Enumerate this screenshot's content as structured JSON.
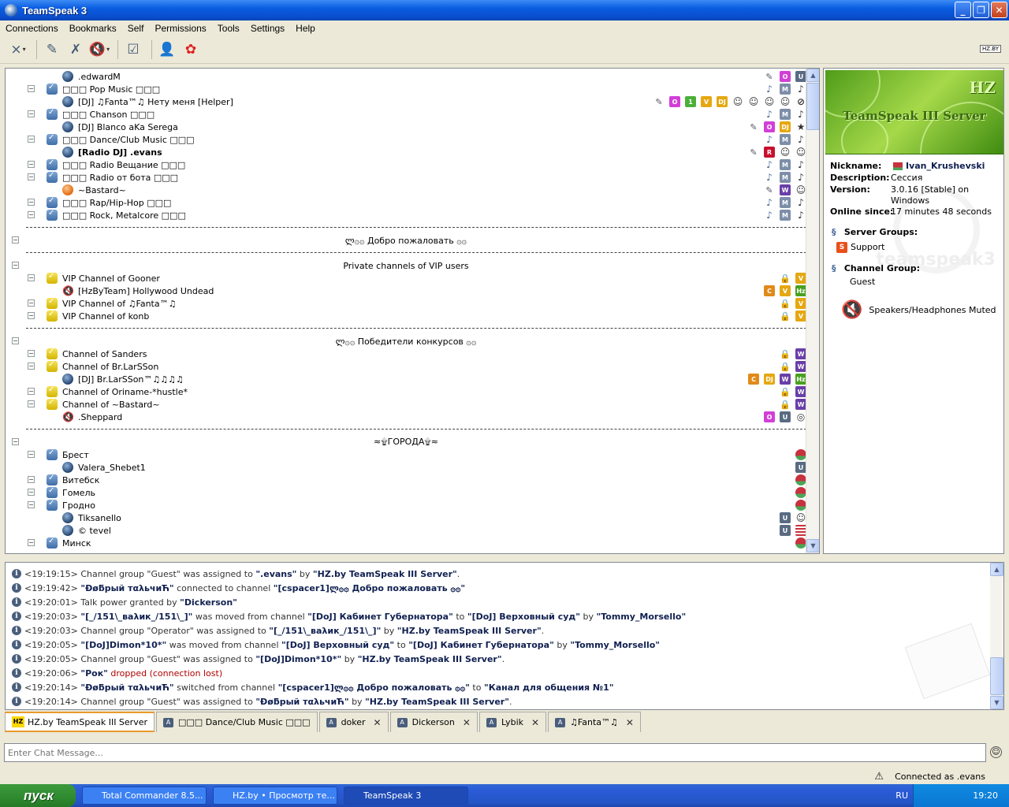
{
  "window": {
    "title": "TeamSpeak 3"
  },
  "menu": [
    "Connections",
    "Bookmarks",
    "Self",
    "Permissions",
    "Tools",
    "Settings",
    "Help"
  ],
  "toolbar_icons": [
    "disconnect-icon",
    "connect-icon",
    "mute-mic-icon",
    "mute-speakers-icon",
    "away-icon",
    "contacts-icon",
    "plugin-icon"
  ],
  "tree": {
    "rows": [
      {
        "type": "client",
        "label": ".edwardM",
        "badges": [
          "mic",
          "O",
          "U"
        ]
      },
      {
        "type": "channel",
        "label": "□□□ Pop Music □□□",
        "badges": [
          "music",
          "M",
          "♪"
        ]
      },
      {
        "type": "client",
        "label": "[DJ] ♫Fanta™♫ Нету меня [Helper]",
        "badges": [
          "mic",
          "O",
          "1",
          "V",
          "DJ",
          "☺",
          "☺",
          "☺",
          "☺",
          "⊘"
        ]
      },
      {
        "type": "channel",
        "label": "□□□ Chanson □□□",
        "badges": [
          "music",
          "M",
          "♪"
        ]
      },
      {
        "type": "client",
        "label": "[DJ] Blanco aKa Serega",
        "badges": [
          "mic",
          "O",
          "DJ",
          "★"
        ]
      },
      {
        "type": "channel",
        "label": "□□□ Dance/Club Music □□□",
        "badges": [
          "music",
          "M",
          "♪"
        ]
      },
      {
        "type": "client",
        "label": "[Radio DJ] .evans",
        "bold": true,
        "badges": [
          "mic",
          "R",
          "☺",
          "☺"
        ]
      },
      {
        "type": "channel",
        "label": "□□□ Radio Вещание □□□",
        "badges": [
          "music",
          "M",
          "♪"
        ]
      },
      {
        "type": "channel",
        "label": "□□□ Radio от бота □□□",
        "badges": [
          "music",
          "M",
          "♪"
        ]
      },
      {
        "type": "client",
        "label": "~Bastard~",
        "away": true,
        "badges": [
          "mic",
          "W",
          "☺"
        ]
      },
      {
        "type": "channel",
        "label": "□□□ Rap/Hip-Hop □□□",
        "badges": [
          "music",
          "M",
          "♪"
        ]
      },
      {
        "type": "channel",
        "label": "□□□ Rock, Metalcore □□□",
        "badges": [
          "music",
          "M",
          "♪"
        ]
      },
      {
        "type": "spacer"
      },
      {
        "type": "center",
        "label": "ლ۞۞ Добро пожаловать ۞۞"
      },
      {
        "type": "spacer"
      },
      {
        "type": "center",
        "label": "Private channels of VIP users"
      },
      {
        "type": "vip",
        "label": "VIP Channel of Gooner",
        "badges": [
          "lock",
          "V"
        ]
      },
      {
        "type": "muted",
        "label": "[HzByTeam] Hollywood Undead",
        "badges": [
          "C",
          "V",
          "Hz"
        ]
      },
      {
        "type": "vip",
        "label": "VIP Channel of ♫Fanta™♫",
        "badges": [
          "lock",
          "V"
        ]
      },
      {
        "type": "vip",
        "label": "VIP Channel of konb",
        "badges": [
          "lock",
          "V"
        ]
      },
      {
        "type": "spacer"
      },
      {
        "type": "center",
        "label": "ლ۞۞ Победители конкурсов ۞۞"
      },
      {
        "type": "vip",
        "label": "Channel of Sanders",
        "badges": [
          "lock",
          "W"
        ]
      },
      {
        "type": "vip",
        "label": "Channel of Br.LarSSon",
        "badges": [
          "lock",
          "W"
        ]
      },
      {
        "type": "client",
        "label": "[DJ] Br.LarSSon™♫♫♫♫",
        "badges": [
          "C",
          "DJ",
          "W",
          "Hz"
        ]
      },
      {
        "type": "vip",
        "label": "Channel of Oriname-*hustle*",
        "badges": [
          "lock",
          "W"
        ]
      },
      {
        "type": "vip",
        "label": "Channel of ~Bastard~",
        "badges": [
          "lock",
          "W"
        ]
      },
      {
        "type": "muted",
        "label": ".Sheppard",
        "badges": [
          "O",
          "U",
          "◎"
        ]
      },
      {
        "type": "spacer"
      },
      {
        "type": "center",
        "label": "≈۩ГОРОДА۩≈"
      },
      {
        "type": "channel",
        "label": "Брест",
        "badges": [
          "flag"
        ]
      },
      {
        "type": "client",
        "label": "Valera_Shebet1",
        "badges": [
          "U"
        ]
      },
      {
        "type": "channel",
        "label": "Витебск",
        "badges": [
          "flag"
        ]
      },
      {
        "type": "channel",
        "label": "Гомель",
        "badges": [
          "flag"
        ]
      },
      {
        "type": "channel",
        "label": "Гродно",
        "badges": [
          "flag"
        ]
      },
      {
        "type": "client",
        "label": "Tiksanello",
        "badges": [
          "U",
          "☺"
        ]
      },
      {
        "type": "client",
        "label": "© tevel",
        "badges": [
          "U",
          "us"
        ]
      },
      {
        "type": "channel",
        "label": "Минск",
        "badges": [
          "flag"
        ]
      }
    ]
  },
  "info": {
    "banner_title": "TeamSpeak III Server",
    "banner_logo": "HZ",
    "nickname_label": "Nickname:",
    "nickname": "Ivan_Krushevski",
    "description_label": "Description:",
    "description": "Сессия",
    "version_label": "Version:",
    "version": "3.0.16 [Stable] on Windows",
    "online_label": "Online since:",
    "online": "17 minutes 48 seconds",
    "server_groups_label": "Server Groups:",
    "server_group": "Support",
    "channel_group_label": "Channel Group:",
    "channel_group": "Guest",
    "watermark": "teamspeak3",
    "audio_status": "Speakers/Headphones Muted"
  },
  "log": [
    [
      [
        "t",
        "<19:19:15> Channel group \"Guest\" was assigned to "
      ],
      [
        "b",
        "\".evans\""
      ],
      [
        "t",
        " by "
      ],
      [
        "b",
        "\"HZ.by TeamSpeak III Server\""
      ],
      [
        "t",
        "."
      ]
    ],
    [
      [
        "t",
        "<19:19:42> "
      ],
      [
        "b",
        "\"Ðøƃрый тαλьчиЋ\""
      ],
      [
        "t",
        " connected to channel "
      ],
      [
        "b",
        "\"[cspacer1]ლ۞۞ Добро пожаловать ۞۞\""
      ]
    ],
    [
      [
        "t",
        "<19:20:01> Talk power granted by "
      ],
      [
        "b",
        "\"Dickerson\""
      ]
    ],
    [
      [
        "t",
        "<19:20:03> "
      ],
      [
        "b",
        "\"[_/151\\_ваλик_/151\\_]\""
      ],
      [
        "t",
        " was moved from channel "
      ],
      [
        "b",
        "\"[DoJ] Кабинет Губернатора\""
      ],
      [
        "t",
        " to "
      ],
      [
        "b",
        "\"[DoJ] Верховный суд\""
      ],
      [
        "t",
        " by "
      ],
      [
        "b",
        "\"Tommy_Morsello\""
      ]
    ],
    [
      [
        "t",
        "<19:20:03> Channel group \"Operator\" was assigned to "
      ],
      [
        "b",
        "\"[_/151\\_ваλик_/151\\_]\""
      ],
      [
        "t",
        " by "
      ],
      [
        "b",
        "\"HZ.by TeamSpeak III Server\""
      ],
      [
        "t",
        "."
      ]
    ],
    [
      [
        "t",
        "<19:20:05> "
      ],
      [
        "b",
        "\"[DoJ]Dimon*10*\""
      ],
      [
        "t",
        " was moved from channel "
      ],
      [
        "b",
        "\"[DoJ] Верховный суд\""
      ],
      [
        "t",
        " to "
      ],
      [
        "b",
        "\"[DoJ] Кабинет Губернатора\""
      ],
      [
        "t",
        " by "
      ],
      [
        "b",
        "\"Tommy_Morsello\""
      ]
    ],
    [
      [
        "t",
        "<19:20:05> Channel group \"Guest\" was assigned to "
      ],
      [
        "b",
        "\"[DoJ]Dimon*10*\""
      ],
      [
        "t",
        " by "
      ],
      [
        "b",
        "\"HZ.by TeamSpeak III Server\""
      ],
      [
        "t",
        "."
      ]
    ],
    [
      [
        "t",
        "<19:20:06> "
      ],
      [
        "b",
        "\"Рок\""
      ],
      [
        "red",
        " dropped (connection lost)"
      ]
    ],
    [
      [
        "t",
        "<19:20:14> "
      ],
      [
        "b",
        "\"Ðøƃрый тαλьчиЋ\""
      ],
      [
        "t",
        " switched from channel "
      ],
      [
        "b",
        "\"[cspacer1]ლ۞۞ Добро пожаловать ۞۞\""
      ],
      [
        "t",
        " to "
      ],
      [
        "b",
        "\"Канал для общения №1\""
      ]
    ],
    [
      [
        "t",
        "<19:20:14> Channel group \"Guest\" was assigned to "
      ],
      [
        "b",
        "\"Ðøƃрый тαλьчиЋ\""
      ],
      [
        "t",
        " by "
      ],
      [
        "b",
        "\"HZ.by TeamSpeak III Server\""
      ],
      [
        "t",
        "."
      ]
    ]
  ],
  "tabs": [
    {
      "label": "HZ.by TeamSpeak III Server",
      "active": true,
      "closable": false
    },
    {
      "label": "□□□ Dance/Club Music □□□",
      "closable": false
    },
    {
      "label": "doker",
      "closable": true
    },
    {
      "label": "Dickerson",
      "closable": true
    },
    {
      "label": "Lybik",
      "closable": true
    },
    {
      "label": "♫Fanta™♫",
      "closable": true
    }
  ],
  "chat": {
    "placeholder": "Enter Chat Message..."
  },
  "status": {
    "text": "Connected as .evans"
  },
  "taskbar": {
    "start": "пуск",
    "tasks": [
      {
        "label": "Total Commander 8.5...",
        "active": false
      },
      {
        "label": "HZ.by • Просмотр те...",
        "active": false
      },
      {
        "label": "TeamSpeak 3",
        "active": true
      }
    ],
    "lang": "RU",
    "clock": "19:20"
  },
  "colors": {
    "O": "#d23fd8",
    "U": "#5a6a82",
    "M": "#7d8ea9",
    "V": "#e5a812",
    "DJ": "#e5a812",
    "1": "#4bb03a",
    "R": "#c8102e",
    "W": "#6a3fa8",
    "C": "#e08a1a",
    "Hz": "#4aa020"
  }
}
